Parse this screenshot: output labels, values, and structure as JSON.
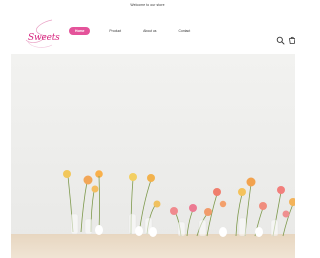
{
  "announcement": {
    "text": "Welcome to our store"
  },
  "header": {
    "logo_text": "Sweets",
    "nav": [
      {
        "label": "Home",
        "active": true
      },
      {
        "label": "Product",
        "active": false
      },
      {
        "label": "About us",
        "active": false
      },
      {
        "label": "Contact",
        "active": false
      }
    ],
    "icons": [
      "search-icon",
      "cart-icon"
    ]
  },
  "colors": {
    "brand_pink": "#e4539a",
    "logo_pink": "#d7257f",
    "hero_wall": "#eeeeec",
    "table": "#eadbc8"
  },
  "hero": {
    "image": "bud vases with orange, yellow and pink ranunculus flowers on a light wooden table against a pale grey wall"
  }
}
